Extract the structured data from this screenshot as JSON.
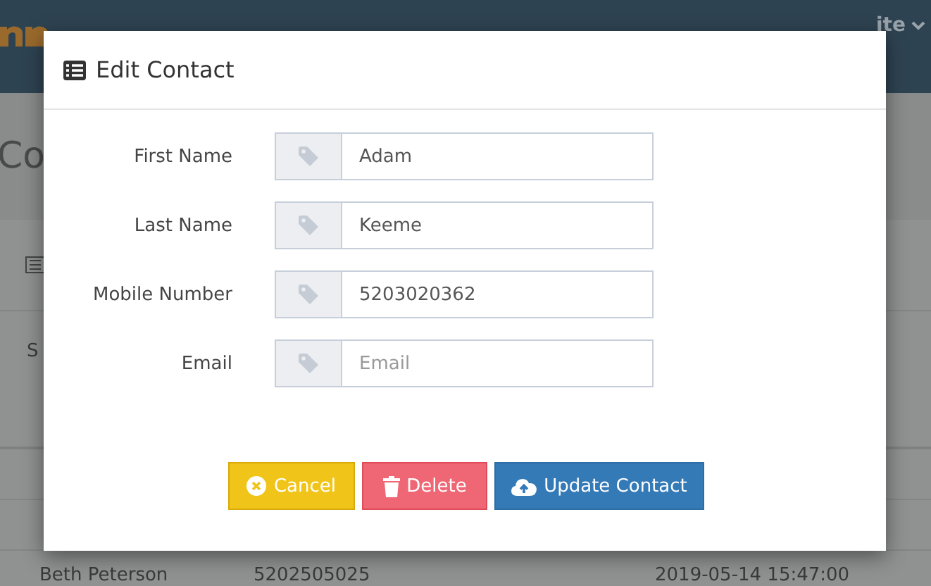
{
  "background": {
    "nav_user": "ite",
    "page_title": "Co",
    "show_label": "S",
    "rows": [
      {},
      {},
      {
        "name": "Beth Peterson",
        "mobile": "5202505025",
        "date": "2019-05-14 15:47:00"
      }
    ]
  },
  "modal": {
    "title": "Edit Contact",
    "fields": [
      {
        "label": "First Name",
        "value": "Adam"
      },
      {
        "label": "Last Name",
        "value": "Keeme"
      },
      {
        "label": "Mobile Number",
        "value": "5203020362"
      },
      {
        "label": "Email",
        "placeholder": "Email"
      }
    ],
    "buttons": [
      {
        "kind": "cancel",
        "label": "Cancel"
      },
      {
        "kind": "delete",
        "label": "Delete"
      },
      {
        "kind": "update",
        "label": "Update Contact"
      }
    ]
  }
}
